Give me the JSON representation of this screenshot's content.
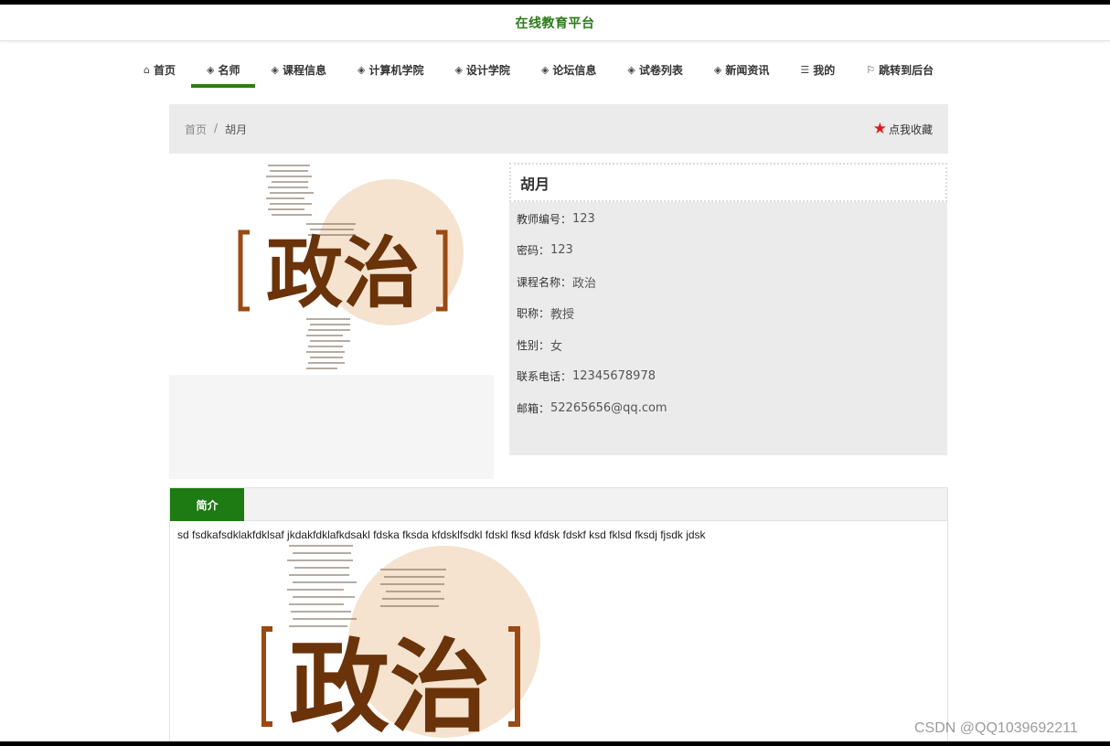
{
  "header": {
    "site_title": "在线教育平台"
  },
  "nav": {
    "items": [
      {
        "label": "首页",
        "icon": "home-icon",
        "glyph": "⌂"
      },
      {
        "label": "名师",
        "icon": "layers-icon",
        "glyph": "◈",
        "active": true
      },
      {
        "label": "课程信息",
        "icon": "layers-icon",
        "glyph": "◈"
      },
      {
        "label": "计算机学院",
        "icon": "layers-icon",
        "glyph": "◈"
      },
      {
        "label": "设计学院",
        "icon": "layers-icon",
        "glyph": "◈"
      },
      {
        "label": "论坛信息",
        "icon": "layers-icon",
        "glyph": "◈"
      },
      {
        "label": "试卷列表",
        "icon": "layers-icon",
        "glyph": "◈"
      },
      {
        "label": "新闻资讯",
        "icon": "layers-icon",
        "glyph": "◈"
      },
      {
        "label": "我的",
        "icon": "menu-icon",
        "glyph": "☰"
      },
      {
        "label": "跳转到后台",
        "icon": "flag-icon",
        "glyph": "⚐"
      }
    ],
    "active_color": "#2a7d17"
  },
  "breadcrumb": {
    "home": "首页",
    "separator": "/",
    "current": "胡月"
  },
  "favorite": {
    "label": "点我收藏",
    "icon": "star-icon",
    "color": "#e01b1b"
  },
  "cover_image": {
    "text": "政治"
  },
  "teacher": {
    "name": "胡月",
    "fields": [
      {
        "label": "教师编号：",
        "value": "123"
      },
      {
        "label": "密码：",
        "value": "123"
      },
      {
        "label": "课程名称：",
        "value": "政治"
      },
      {
        "label": "职称：",
        "value": "教授"
      },
      {
        "label": "性别：",
        "value": "女"
      },
      {
        "label": "联系电话：",
        "value": "12345678978"
      },
      {
        "label": "邮箱：",
        "value": "52265656@qq.com"
      }
    ]
  },
  "tabs": {
    "items": [
      {
        "label": "简介",
        "active": true
      }
    ],
    "active_color": "#1e7a12"
  },
  "intro": {
    "text": "sd fsdkafsdklakfdklsaf jkdakfdklafkdsakl fdska fksda kfdsklfsdkl fdskl fksd kfdsk fdskf ksd fklsd fksdj fjsdk jdsk",
    "image_text": "政治"
  },
  "watermark": "CSDN @QQ1039692211"
}
